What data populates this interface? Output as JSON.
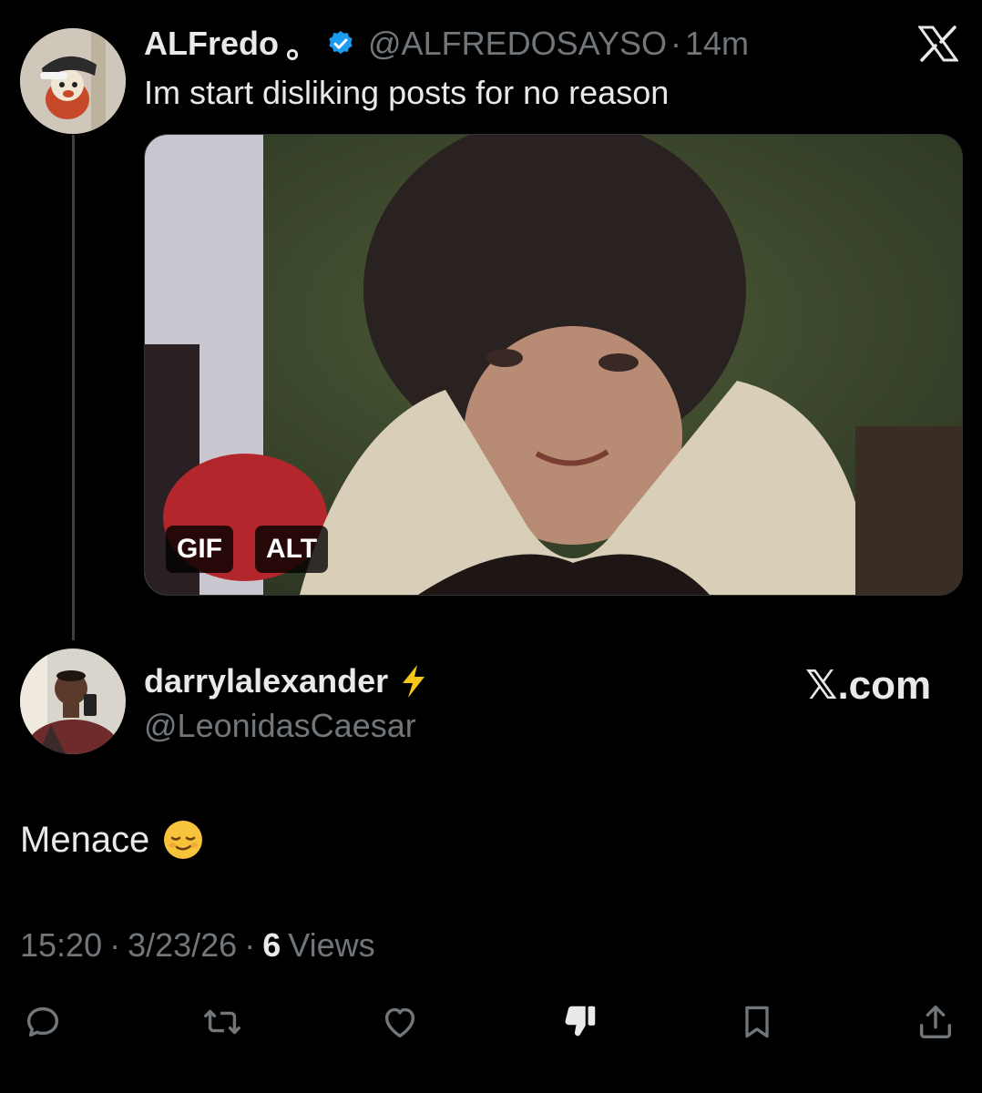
{
  "quoted_post": {
    "author_name": "ALFredo",
    "name_suffix": "。",
    "handle": "@ALFREDOSAYSO",
    "separator": "·",
    "time": "14m",
    "text": "Im start disliking posts for no reason",
    "verified_color": "#1d9bf0",
    "media": {
      "badges": [
        "GIF",
        "ALT"
      ]
    }
  },
  "reply": {
    "author_name": "darrylalexander",
    "emoji_badge": "⚡",
    "handle": "@LeonidasCaesar",
    "source_label": "𝕏.com",
    "text": "Menace",
    "text_emoji": "😌"
  },
  "meta": {
    "time": "15:20",
    "sep1": "·",
    "date": "3/23/26",
    "sep2": "·",
    "views_count": "6",
    "views_label": "Views"
  },
  "actions": [
    "reply-icon",
    "repost-icon",
    "like-icon",
    "dislike-icon",
    "bookmark-icon",
    "share-icon"
  ],
  "colors": {
    "background": "#000000",
    "text": "#e7e9ea",
    "muted": "#71767b",
    "accent": "#1d9bf0"
  }
}
